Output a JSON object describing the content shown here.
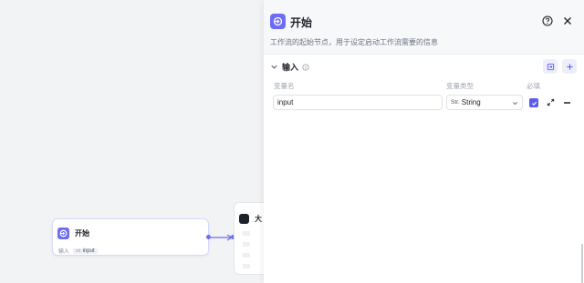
{
  "canvas": {
    "start_node": {
      "title": "开始",
      "input_label": "输入",
      "input_tag_prefix": "str",
      "input_tag": "input"
    },
    "llm_node": {
      "title": "大"
    }
  },
  "panel": {
    "title": "开始",
    "description": "工作流的起始节点，用于设定启动工作流需要的信息",
    "section": {
      "title": "输入",
      "columns": {
        "name": "变量名",
        "type": "变量类型",
        "required": "必填"
      },
      "rows": [
        {
          "name": "input",
          "type_prefix": "Str.",
          "type": "String",
          "required": true
        }
      ]
    }
  },
  "colors": {
    "accent": "#6d6cf7",
    "checkbox": "#5b5bf0"
  },
  "icons": [
    "start-node-icon",
    "help-icon",
    "close-icon",
    "chevron-down-icon",
    "info-icon",
    "import-icon",
    "add-icon",
    "dropdown-chevron-icon",
    "check-icon",
    "expand-icon",
    "minus-icon"
  ]
}
